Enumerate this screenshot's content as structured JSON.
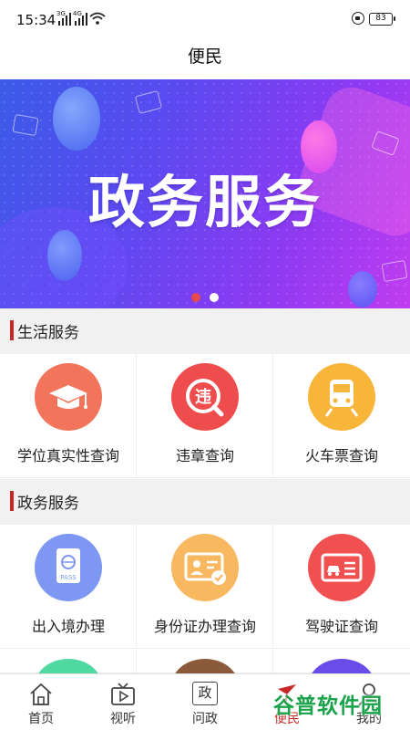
{
  "status_bar": {
    "time": "15:34",
    "net1": "3G",
    "net2": "4G",
    "battery": "83"
  },
  "header": {
    "title": "便民"
  },
  "banner": {
    "text": "政务服务",
    "pager_count": 2,
    "active_index": 0,
    "colors": {
      "active": "#e84a4a",
      "inactive": "#ffffff"
    }
  },
  "sections": [
    {
      "title": "生活服务",
      "items": [
        {
          "label": "学位真实性查询",
          "icon": "graduation-cap-icon",
          "color": "#f2745a"
        },
        {
          "label": "违章查询",
          "icon": "traffic-violation-icon",
          "color": "#ef4d4d"
        },
        {
          "label": "火车票查询",
          "icon": "train-icon",
          "color": "#f7b53a"
        }
      ]
    },
    {
      "title": "政务服务",
      "items": [
        {
          "label": "出入境办理",
          "icon": "passport-icon",
          "color": "#7d97f2"
        },
        {
          "label": "身份证办理查询",
          "icon": "id-card-icon",
          "color": "#f7b860"
        },
        {
          "label": "驾驶证查询",
          "icon": "driver-license-icon",
          "color": "#f05050"
        }
      ],
      "partial_row_colors": [
        "#4fd8a0",
        "#8a5a3a",
        "#6a4de8"
      ]
    }
  ],
  "bottom_nav": [
    {
      "label": "首页",
      "icon": "home-icon"
    },
    {
      "label": "视听",
      "icon": "tv-icon"
    },
    {
      "label": "问政",
      "icon": "zheng-icon",
      "glyph": "政"
    },
    {
      "label": "便民",
      "icon": "convenience-icon",
      "active": true
    },
    {
      "label": "我的",
      "icon": "profile-icon"
    }
  ],
  "accent_color": "#c62828",
  "watermark": "谷普软件园"
}
